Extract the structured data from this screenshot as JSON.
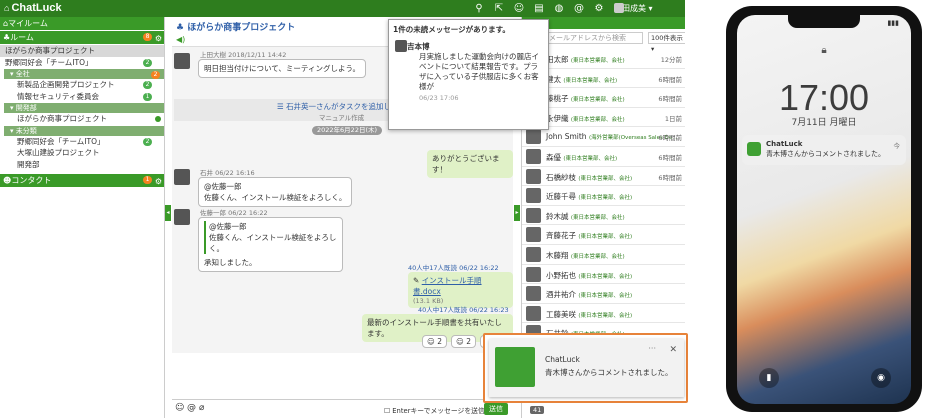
{
  "topbar": {
    "app_name": "ChatLuck",
    "user_name": "太田成美"
  },
  "left": {
    "myroom": "マイルーム",
    "room_header": "ルーム",
    "room_badge": "8",
    "rooms": [
      {
        "label": "ほがらか商事プロジェクト",
        "selected": true
      },
      {
        "label": "野郷同好会「チームITO」",
        "badge": "2"
      }
    ],
    "groups": [
      {
        "name": "全社",
        "badge": "2",
        "items": [
          {
            "label": "新製品企画開発プロジェクト",
            "badge": "2"
          },
          {
            "label": "情報セキュリティ委員会",
            "badge": "1"
          }
        ]
      },
      {
        "name": "開発部",
        "items": [
          {
            "label": "ほがらか商事プロジェクト",
            "dot": true
          }
        ]
      },
      {
        "name": "未分類",
        "items": [
          {
            "label": "野郷同好会「チームITO」",
            "badge": "2"
          },
          {
            "label": "大塚山建設プロジェクト"
          },
          {
            "label": "開発部"
          }
        ]
      }
    ],
    "contact_header": "コンタクト",
    "contact_badge": "1"
  },
  "center": {
    "title": "ほがらか商事プロジェクト",
    "msg1": {
      "meta": "上田大樹 2018/12/11 14:42",
      "text": "明日担当付けについて、ミーティングしよう。"
    },
    "task": {
      "text": "石井英一さんがタスクを追加しまし",
      "sub": "マニュアル作成"
    },
    "date": "2022年6月22日(木)",
    "msg2": {
      "text": "ありがとうございます！"
    },
    "msg3": {
      "meta": "石井 06/22 16:16",
      "mention": "@佐藤一郎",
      "text": "佐藤くん、インストール検証をよろしく。"
    },
    "msg4": {
      "meta": "佐藤一郎 06/22 16:22",
      "mention": "@佐藤一郎",
      "text": "佐藤くん、インストール検証をよろしく。",
      "reply": "承知しました。"
    },
    "file": {
      "read": "40人中17人既読 06/22 16:22",
      "name": "インストール手順書.docx",
      "size": "(13.1 KB)"
    },
    "msg5": {
      "read": "40人中17人既読 06/22 16:23",
      "text": "最新のインストール手順書を共有いたします。"
    },
    "reactions": [
      "2",
      "2",
      "2"
    ],
    "enter_label": "Enterキーでメッセージを送信",
    "send_label": "送信"
  },
  "right": {
    "search_placeholder": "メールアドレスから検索",
    "per_page": "100件表示",
    "contacts": [
      {
        "name": "田太郎",
        "dept": "(東日本営業部、会社)",
        "time": "12分前"
      },
      {
        "name": "健太",
        "dept": "(東日本営業部、会社)",
        "time": "6時間前"
      },
      {
        "name": "藤桃子",
        "dept": "(東日本営業部、会社)",
        "time": "6時間前"
      },
      {
        "name": "永伊織",
        "dept": "(東日本営業部、会社)",
        "time": "1日前"
      },
      {
        "name": "John Smith",
        "dept": "(海外営業部(Overseas Sales De...",
        "time": "6時間前"
      },
      {
        "name": "森優",
        "dept": "(東日本営業部、会社)",
        "time": "6時間前"
      },
      {
        "name": "石橋紗枝",
        "dept": "(東日本営業部、会社)",
        "time": "6時間前"
      },
      {
        "name": "近藤千尋",
        "dept": "(東日本営業部、会社)",
        "time": ""
      },
      {
        "name": "鈴木誠",
        "dept": "(東日本営業部、会社)",
        "time": ""
      },
      {
        "name": "斉藤花子",
        "dept": "(東日本営業部、会社)",
        "time": ""
      },
      {
        "name": "木藤翔",
        "dept": "(東日本営業部、会社)",
        "time": ""
      },
      {
        "name": "小野拓也",
        "dept": "(東日本営業部、会社)",
        "time": ""
      },
      {
        "name": "酒井祐介",
        "dept": "(東日本営業部、会社)",
        "time": ""
      },
      {
        "name": "工藤美咲",
        "dept": "(東日本営業部、会社)",
        "time": ""
      },
      {
        "name": "石井鈴",
        "dept": "(東日本営業部、会社)",
        "time": ""
      },
      {
        "name": "吉田誠",
        "dept": "(東日本営業部、会社)",
        "time": ""
      }
    ],
    "count": "41"
  },
  "popup": {
    "header": "1件の未読メッセージがあります。",
    "name": "吉本博",
    "text": "月実施しました運動会向けの麗店イベントについて結果報告です。プラザに入っている子供服店に多くお客様が",
    "time": "06/23 17:06"
  },
  "notification": {
    "title": "ChatLuck",
    "body": "青木博さんからコメントされました。"
  },
  "phone": {
    "time": "17:00",
    "date": "7月11日 月曜日",
    "notif_app": "ChatLuck",
    "notif_body": "青木博さんからコメントされました。",
    "notif_when": "今"
  },
  "colors": {
    "brand": "#2e7d1e",
    "accent_orange": "#e7833a"
  },
  "icons": [
    "search-icon",
    "export-icon",
    "contacts-icon",
    "chat-icon",
    "globe-icon",
    "at-icon",
    "settings-icon"
  ]
}
